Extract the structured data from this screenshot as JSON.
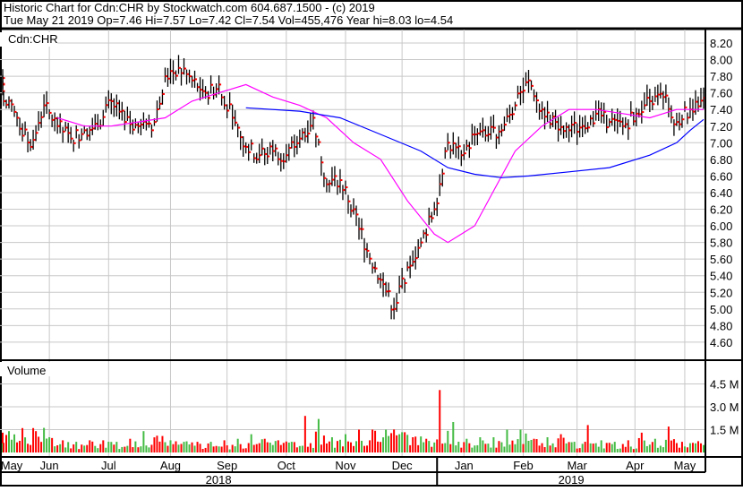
{
  "header": {
    "line1": "Historic Chart for Cdn:CHR by Stockwatch.com 604.687.1500 - (c) 2019",
    "line2": "Tue May 21 2019  Op=7.46  Hi=7.57  Lo=7.42  Cl=7.54  Vol=455,476  Year hi=8.03  lo=4.54"
  },
  "colors": {
    "bar": "#000000",
    "close_tick": "#ff0000",
    "ma_short": "#ff00ff",
    "ma_long": "#0000ff",
    "vol_up": "#44bb44",
    "vol_down": "#ff0000",
    "grid": "#c8c8c8"
  },
  "chart_data": [
    {
      "type": "line",
      "title": "Cdn:CHR",
      "subtype": "ohlc",
      "x_unit": "week index (week of May 21 2018 = 0)",
      "ylim": [
        4.4,
        8.3
      ],
      "yticks": [
        "8.20",
        "8.00",
        "7.80",
        "7.60",
        "7.40",
        "7.20",
        "7.00",
        "6.80",
        "6.60",
        "6.40",
        "6.20",
        "6.00",
        "5.80",
        "5.60",
        "5.40",
        "5.20",
        "5.00",
        "4.80",
        "4.60"
      ],
      "weekly_close": [
        7.5,
        7.3,
        6.95,
        7.45,
        7.2,
        7.05,
        7.15,
        7.2,
        7.5,
        7.25,
        7.2,
        7.15,
        7.8,
        7.9,
        7.75,
        7.6,
        7.7,
        7.3,
        6.95,
        6.85,
        6.9,
        6.85,
        7.05,
        7.3,
        6.5,
        6.55,
        6.2,
        5.7,
        5.35,
        5.0,
        5.5,
        5.8,
        6.2,
        7.0,
        6.85,
        7.1,
        7.1,
        7.15,
        7.45,
        7.75,
        7.4,
        7.25,
        7.15,
        7.2,
        7.35,
        7.25,
        7.2,
        7.35,
        7.5,
        7.55,
        7.25,
        7.4,
        7.54
      ],
      "first_open": 7.85,
      "series": [
        {
          "name": "short moving average",
          "color": "#ff00ff",
          "x": [
            4,
            6,
            8,
            10,
            12,
            14,
            16,
            18,
            20,
            22,
            24,
            26,
            28,
            30,
            32,
            33,
            35,
            37,
            38,
            40,
            42,
            44,
            46,
            48,
            50,
            52
          ],
          "values": [
            7.3,
            7.2,
            7.2,
            7.25,
            7.3,
            7.5,
            7.6,
            7.7,
            7.55,
            7.45,
            7.3,
            7.0,
            6.8,
            6.3,
            5.9,
            5.8,
            6.0,
            6.6,
            6.9,
            7.2,
            7.4,
            7.4,
            7.35,
            7.3,
            7.4,
            7.4
          ]
        },
        {
          "name": "long moving average",
          "color": "#0000ff",
          "x": [
            18,
            22,
            25,
            28,
            31,
            33,
            35,
            37,
            39,
            42,
            45,
            48,
            50,
            51,
            52
          ],
          "values": [
            7.42,
            7.38,
            7.3,
            7.1,
            6.9,
            6.7,
            6.62,
            6.58,
            6.6,
            6.65,
            6.7,
            6.85,
            7.0,
            7.15,
            7.28
          ]
        }
      ]
    },
    {
      "type": "bar",
      "title": "Volume",
      "unit": "M",
      "ylim": [
        0,
        6
      ],
      "yticks": [
        "4.5 M",
        "3.0 M",
        "1.5 M"
      ],
      "weekly_avg_volume": [
        0.6,
        0.8,
        0.9,
        1.1,
        0.8,
        0.5,
        0.4,
        0.5,
        0.5,
        0.4,
        0.5,
        0.5,
        0.8,
        0.6,
        0.5,
        0.4,
        0.4,
        0.4,
        0.5,
        0.6,
        0.7,
        0.6,
        0.5,
        0.5,
        1.0,
        0.6,
        0.5,
        0.7,
        1.2,
        1.1,
        0.9,
        0.8,
        0.6,
        1.0,
        0.6,
        0.5,
        0.6,
        0.6,
        0.7,
        0.9,
        0.6,
        0.6,
        0.7,
        0.5,
        0.5,
        0.5,
        0.4,
        0.4,
        0.8,
        0.5,
        0.8,
        0.6,
        0.5
      ],
      "weekly_peak_volume": [
        1.3,
        1.4,
        1.6,
        1.4,
        1.0,
        0.8,
        0.7,
        0.8,
        0.8,
        0.7,
        0.9,
        1.4,
        1.1,
        0.8,
        0.7,
        0.7,
        0.7,
        0.8,
        0.9,
        1.2,
        0.9,
        0.8,
        0.7,
        2.4,
        2.2,
        1.0,
        1.2,
        1.5,
        1.5,
        1.5,
        1.2,
        1.0,
        0.9,
        4.1,
        2.0,
        0.9,
        1.0,
        1.0,
        1.5,
        1.5,
        0.9,
        1.0,
        1.2,
        0.7,
        1.8,
        0.8,
        0.7,
        0.8,
        1.3,
        0.9,
        1.7,
        0.7,
        0.6
      ]
    }
  ],
  "x_axis": {
    "months": [
      {
        "label": "May",
        "x": 0.6
      },
      {
        "label": "Jun",
        "x": 3.4
      },
      {
        "label": "Jul",
        "x": 7.8
      },
      {
        "label": "Aug",
        "x": 12.4
      },
      {
        "label": "Sep",
        "x": 16.6
      },
      {
        "label": "Oct",
        "x": 21.0
      },
      {
        "label": "Nov",
        "x": 25.4
      },
      {
        "label": "Dec",
        "x": 29.6
      },
      {
        "label": "Jan",
        "x": 34.2
      },
      {
        "label": "Feb",
        "x": 38.6
      },
      {
        "label": "Mar",
        "x": 42.6
      },
      {
        "label": "Apr",
        "x": 46.9
      },
      {
        "label": "May",
        "x": 50.6
      }
    ],
    "years": [
      {
        "label": "2018"
      },
      {
        "label": "2019"
      }
    ],
    "year_break": 32.2
  }
}
